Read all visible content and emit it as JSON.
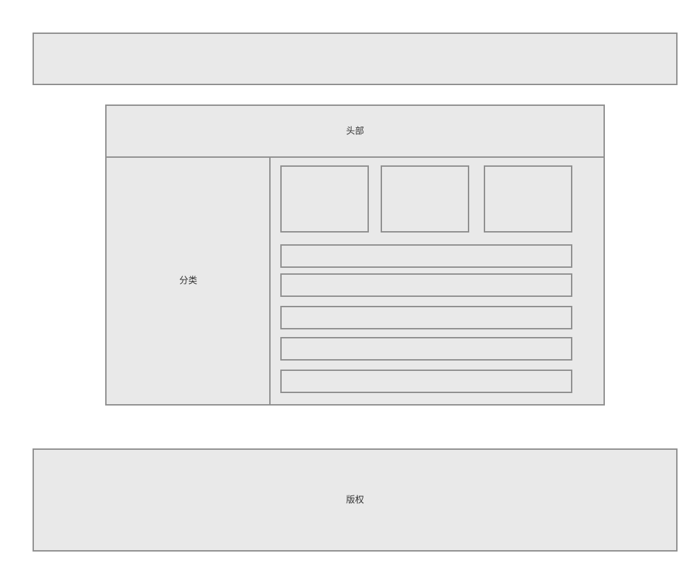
{
  "header": {
    "label": "头部"
  },
  "sidebar": {
    "label": "分类"
  },
  "footer": {
    "label": "版权"
  },
  "colors": {
    "box_fill": "#e9e9e9",
    "box_border": "#8f8f8f",
    "text": "#333333"
  }
}
